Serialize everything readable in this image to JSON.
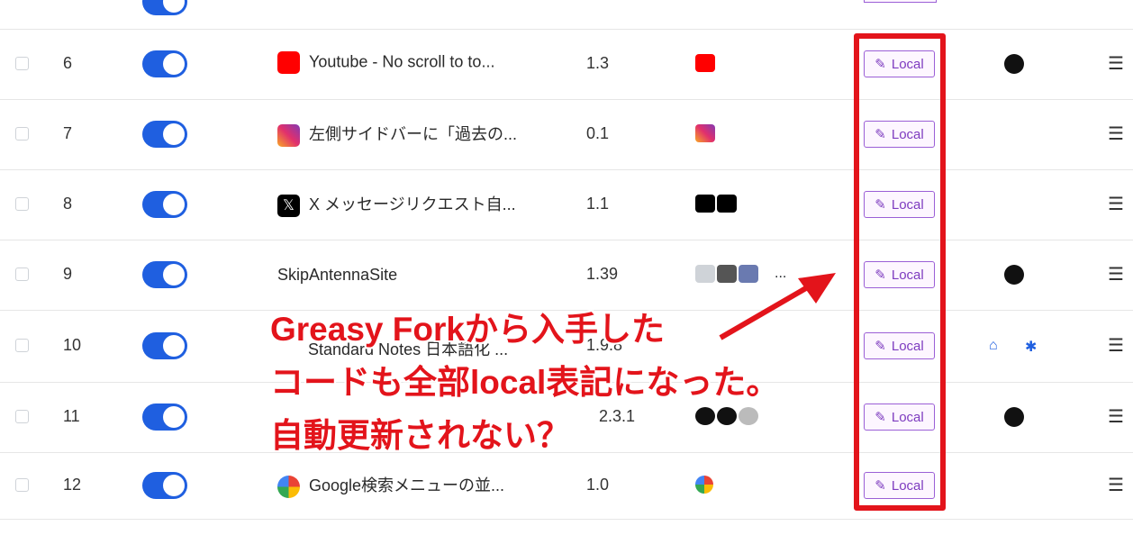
{
  "rows": [
    {
      "index": "6",
      "name": "Youtube - No scroll to to...",
      "version": "1.3",
      "local": "Local",
      "has_extra": true
    },
    {
      "index": "7",
      "name": "左側サイドバーに「過去の...",
      "version": "0.1",
      "local": "Local",
      "has_extra": false
    },
    {
      "index": "8",
      "name": "X メッセージリクエスト自...",
      "version": "1.1",
      "local": "Local",
      "has_extra": false
    },
    {
      "index": "9",
      "name": "SkipAntennaSite",
      "version": "1.39",
      "local": "Local",
      "has_extra": true,
      "sites_more": "..."
    },
    {
      "index": "10",
      "name": "Standard Notes 日本語化 ...",
      "version": "1.9.8",
      "local": "Local",
      "has_extra": false
    },
    {
      "index": "11",
      "name": "",
      "version": "2.3.1",
      "local": "Local",
      "has_extra": true
    },
    {
      "index": "12",
      "name": "Google検索メニューの並...",
      "version": "1.0",
      "local": "Local",
      "has_extra": false
    }
  ],
  "annotation": {
    "line1": "Greasy Forkから入手した",
    "line2": "コードも全部local表記になった。",
    "line3": "自動更新されない？"
  },
  "colors": {
    "accent": "#1f5fe0",
    "annotation": "#e3141b",
    "local_border": "#9b5fd6"
  }
}
